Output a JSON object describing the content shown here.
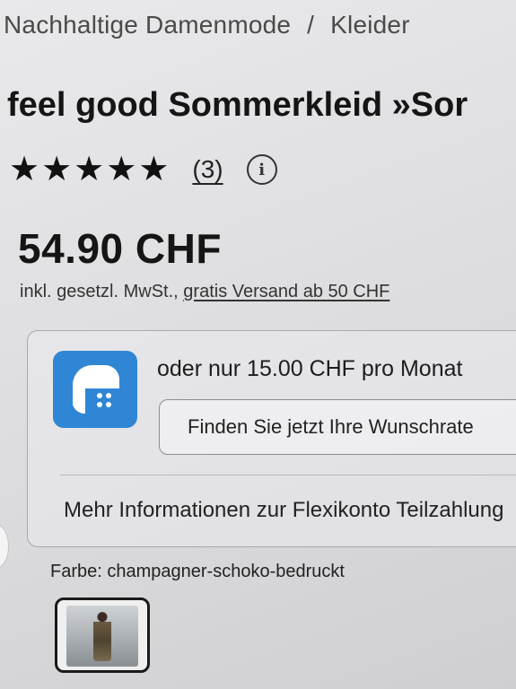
{
  "breadcrumb": {
    "category": "Nachhaltige Damenmode",
    "separator": "/",
    "subcategory": "Kleider"
  },
  "product": {
    "title": "feel good Sommerkleid »Sor"
  },
  "rating": {
    "stars": 5,
    "max_stars": 5,
    "star_char": "★",
    "reviews": "(3)",
    "info_icon_glyph": "i"
  },
  "price": {
    "amount": "54.90 CHF",
    "vat_text": "inkl. gesetzl. MwSt., ",
    "shipping_link": "gratis Versand ab 50 CHF"
  },
  "financing": {
    "icon": "flexikonto-app-icon",
    "installment_text": "oder nur 15.00 CHF pro Monat",
    "cta_label": "Finden Sie jetzt Ihre Wunschrate",
    "more_info": "Mehr Informationen zur Flexikonto Teilzahlung"
  },
  "color": {
    "label": "Farbe: champagner-schoko-bedruckt"
  },
  "colors": {
    "accent_blue": "#2f86d4",
    "text": "#1b1b1b"
  }
}
